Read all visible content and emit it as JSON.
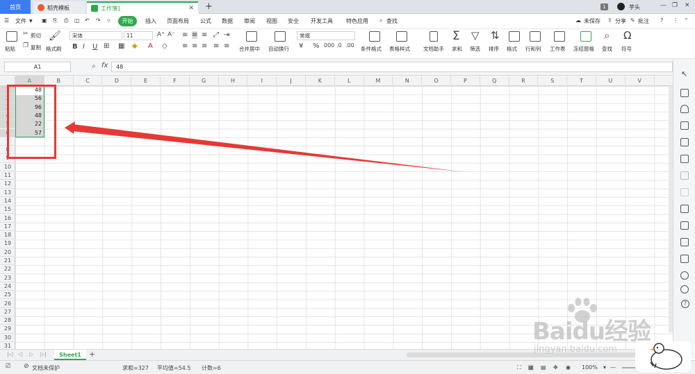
{
  "titlebar": {
    "tabs": [
      {
        "label": "首页"
      },
      {
        "label": "稻壳模板"
      },
      {
        "label": "工作簿1"
      }
    ],
    "add_tab": "+",
    "page_num": "1",
    "user": "芋头"
  },
  "menu": {
    "file": "文件",
    "items": [
      "开始",
      "插入",
      "页面布局",
      "公式",
      "数据",
      "审阅",
      "视图",
      "安全",
      "开发工具",
      "特色应用"
    ],
    "search": "查找",
    "unsaved": "未保存",
    "share": "分享",
    "comment": "批注"
  },
  "ribbon": {
    "paste": "粘贴",
    "cut": "剪切",
    "copy": "复制",
    "format_painter": "格式刷",
    "font_name": "宋体",
    "font_size": "11",
    "merge_center": "合并居中",
    "auto_wrap": "自动换行",
    "number_format": "常规",
    "conditional_format": "条件格式",
    "table_style": "表格样式",
    "doc_assistant": "文档助手",
    "sum": "求和",
    "filter": "筛选",
    "sort": "排序",
    "format": "格式",
    "row_col": "行和列",
    "worksheet": "工作表",
    "freeze": "冻结窗格",
    "find": "查找",
    "symbol": "符号"
  },
  "formula_bar": {
    "name_box": "A1",
    "fx": "fx",
    "value": "48"
  },
  "grid": {
    "columns": [
      "A",
      "B",
      "C",
      "D",
      "E",
      "F",
      "G",
      "H",
      "I",
      "J",
      "K",
      "L",
      "M",
      "N",
      "O",
      "P",
      "Q",
      "R",
      "S",
      "T",
      "U",
      "V"
    ],
    "rows": [
      "1",
      "2",
      "3",
      "4",
      "5",
      "6",
      "7",
      "8",
      "9",
      "10",
      "11",
      "12",
      "13",
      "14",
      "15",
      "16",
      "17",
      "18",
      "19",
      "20",
      "21",
      "22",
      "23",
      "24",
      "25",
      "26",
      "27",
      "28",
      "29",
      "30",
      "31"
    ],
    "column_a_values": [
      "48",
      "56",
      "96",
      "48",
      "22",
      "57"
    ]
  },
  "sheets": {
    "active": "Sheet1",
    "add": "+"
  },
  "status": {
    "doc_protect": "文档未保护",
    "sum": "求和=327",
    "average": "平均值=54.5",
    "count": "计数=6",
    "zoom": "100%"
  },
  "watermark": {
    "logo": "Baidu经验",
    "url": "jingyan.baidu.com"
  },
  "colors": {
    "accent_green": "#2fa84f",
    "home_tab_blue": "#3d7cf0",
    "annotation_red": "#e53935"
  }
}
